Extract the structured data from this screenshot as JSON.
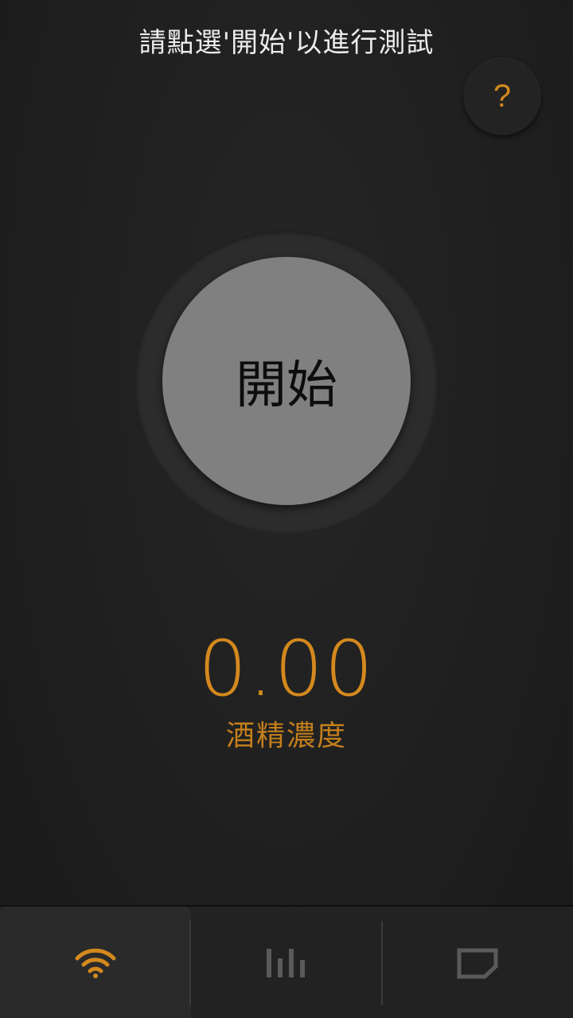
{
  "header": {
    "instruction": "請點選'開始'以進行測試",
    "help_label": "?"
  },
  "main": {
    "start_label": "開始",
    "reading_value": "0.00",
    "reading_label": "酒精濃度"
  },
  "tabbar": {
    "tabs": [
      {
        "icon": "wifi-signal-icon",
        "active": true
      },
      {
        "icon": "bar-chart-icon",
        "active": false
      },
      {
        "icon": "note-icon",
        "active": false
      }
    ]
  },
  "colors": {
    "accent": "#d4891e",
    "button_fill": "#808080",
    "background": "#1e1e1e",
    "inactive_icon": "#5a5a5a"
  }
}
